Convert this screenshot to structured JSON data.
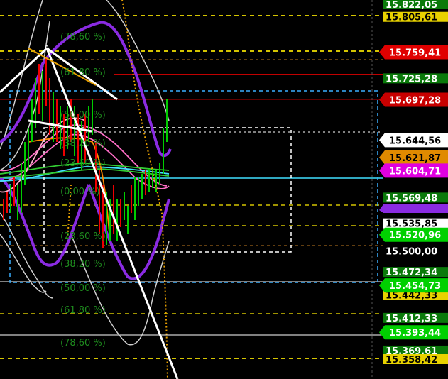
{
  "chart_data": {
    "type": "candlestick",
    "y_axis_side": "right",
    "price_labels": [
      {
        "value": "15.822,05",
        "bg": "#0a7a0a",
        "fg": "#ffffff"
      },
      {
        "value": "15.805,61",
        "bg": "#e8d200",
        "fg": "#000000"
      },
      {
        "value": "15.759,41",
        "bg": "#e00000",
        "fg": "#ffffff"
      },
      {
        "value": "15.725,28",
        "bg": "#0a7a0a",
        "fg": "#ffffff"
      },
      {
        "value": "15.697,28",
        "bg": "#c80000",
        "fg": "#ffffff"
      },
      {
        "value": "15.644,56",
        "bg": "#ffffff",
        "fg": "#000000"
      },
      {
        "value": "15.621,87",
        "bg": "#e08a00",
        "fg": "#000000"
      },
      {
        "value": "15.604,71",
        "bg": "#e000e0",
        "fg": "#ffffff"
      },
      {
        "value": "15.569,48",
        "bg": "#0a7a0a",
        "fg": "#ffffff"
      },
      {
        "value": "15.535,85",
        "bg": "#ffffff",
        "fg": "#000000"
      },
      {
        "value": "15.520,96",
        "bg": "#00d000",
        "fg": "#ffffff"
      },
      {
        "value": "15.500,00",
        "bg": "#000000",
        "fg": "#ffffff"
      },
      {
        "value": "15.472,34",
        "bg": "#0a7a0a",
        "fg": "#ffffff"
      },
      {
        "value": "15.454,73",
        "bg": "#00d000",
        "fg": "#ffffff"
      },
      {
        "value": "15.442,33",
        "bg": "#e8d200",
        "fg": "#000000"
      },
      {
        "value": "15.412,33",
        "bg": "#0a7a0a",
        "fg": "#ffffff"
      },
      {
        "value": "15.393,44",
        "bg": "#00d000",
        "fg": "#ffffff"
      },
      {
        "value": "15.369,61",
        "bg": "#0a7a0a",
        "fg": "#ffffff"
      },
      {
        "value": "15.358,42",
        "bg": "#e8d200",
        "fg": "#000000"
      }
    ],
    "fib_labels": [
      "(78,60 %)",
      "(61,80 %)",
      "(50,00 %)",
      "(38,20 %)",
      "(23,60 %)",
      "(0,00 %)",
      "(23,60 %)",
      "(38,20 %)",
      "(50,00 %)",
      "(61,80 %)",
      "(78,60 %)"
    ],
    "colors": {
      "bollinger": "#cfcfcf",
      "envelope": "#8a2be2",
      "ma_pink": "#ff6ec7",
      "ma_cyan": "#40e0ff",
      "ma_green": "#32cd32",
      "ma_orange": "#ff8c00",
      "trendline": "#ffffff",
      "fib_text": "#1e8c1e",
      "level_yellow": "#d4c400",
      "level_red": "#c00000",
      "box_cyan": "#3ab0ff"
    }
  }
}
